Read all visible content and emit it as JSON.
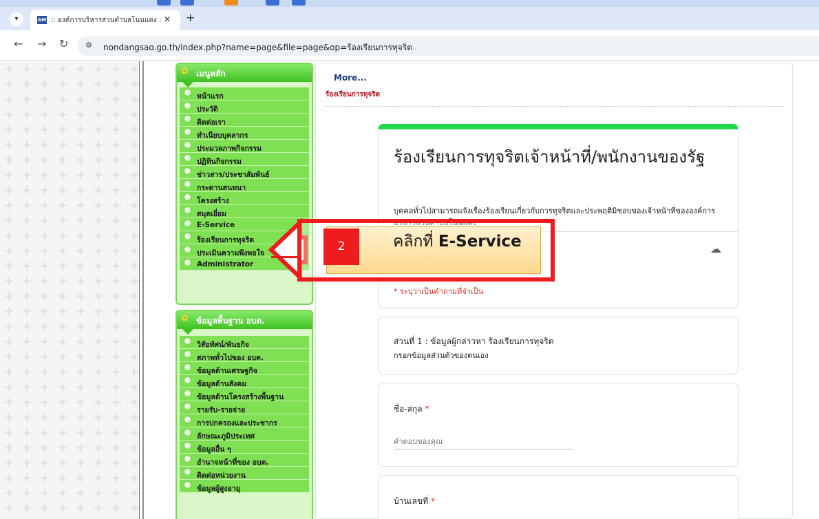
{
  "browser": {
    "tab_title": ":: องค์การบริหารส่วนตำบลโนนแดง :: ",
    "tab_favicon": "AM",
    "url": "nondangsao.go.th/index.php?name=page&file=page&op=ร้องเรียนการทุจริต",
    "icons": [
      "tab-list-icon",
      "close-icon",
      "new-tab-icon",
      "back-icon",
      "forward-icon",
      "reload-icon",
      "site-info-icon"
    ]
  },
  "main_menu": {
    "title": "เมนูหลัก",
    "items": [
      {
        "label": "หน้าแรก"
      },
      {
        "label": "ประวัติ"
      },
      {
        "label": "ติดต่อเรา"
      },
      {
        "label": "ทำเนียบบุคลากร"
      },
      {
        "label": "ประมวลภาพกิจกรรม"
      },
      {
        "label": "ปฏิทินกิจกรรม"
      },
      {
        "label": "ข่าวสาร/ประชาสัมพันธ์"
      },
      {
        "label": "กระดานสนทนา"
      },
      {
        "label": "โครงสร้าง"
      },
      {
        "label": "สมุดเยี่ยม"
      },
      {
        "label": "E-Service"
      },
      {
        "label": "ร้องเรียนการทุจริต"
      },
      {
        "label": "ประเมินความพึงพอใจ"
      },
      {
        "label": "Administrator"
      }
    ]
  },
  "info_menu": {
    "title": "ข้อมูลพื้นฐาน อบต.",
    "items": [
      {
        "label": "วิสัยทัศน์/พันธกิจ"
      },
      {
        "label": "สภาพทั่วไปของ อบต."
      },
      {
        "label": "ข้อมูลด้านเศรษฐกิจ"
      },
      {
        "label": "ข้อมูลด้านสังคม"
      },
      {
        "label": "ข้อมูลด้านโครงสร้างพื้นฐาน"
      },
      {
        "label": "รายรับ-รายจ่าย"
      },
      {
        "label": "การปกครองและประชากร"
      },
      {
        "label": "ลักษณะภูมิประเทศ"
      },
      {
        "label": "ข้อมูลอื่น ๆ"
      },
      {
        "label": "อำนาจหน้าที่ของ อบต."
      },
      {
        "label": "ติดต่อหน่วยงาน"
      },
      {
        "label": "ข้อมูลผู้สูงอายุ"
      }
    ]
  },
  "content": {
    "more_link": "More...",
    "breadcrumb": "ร้องเรียนการทุจริต"
  },
  "form": {
    "title": "ร้องเรียนการทุจริตเจ้าหน้าที่/พนักงานของรัฐ",
    "description": "บุคคลทั่วไปสามารถแจ้งเรื่องร้องเรียนเกี่ยวกับการทุจริตและประพฤติมิชอบของเจ้าหน้าที่ขององค์การบริหารส่วนตำบลโนนแดง",
    "required_note": "* ระบุว่าเป็นคำถามที่จำเป็น",
    "section_title": "ส่วนที่ 1 : ข้อมูลผู้กล่าวหา ร้องเรียนการทุจริต",
    "section_subtitle": "กรอกข้อมูลส่วนตัวของตนเอง",
    "q1_label": "ชื่อ-สกุล",
    "q1_placeholder": "คำตอบของคุณ",
    "q2_label": "บ้านเลขที่",
    "required_star": "*",
    "accent_color": "#22d64a"
  },
  "annotation": {
    "step_number": "2",
    "text_prefix": "คลิกที่ ",
    "text_target": "E-Service",
    "color": "#ee1c1c"
  }
}
